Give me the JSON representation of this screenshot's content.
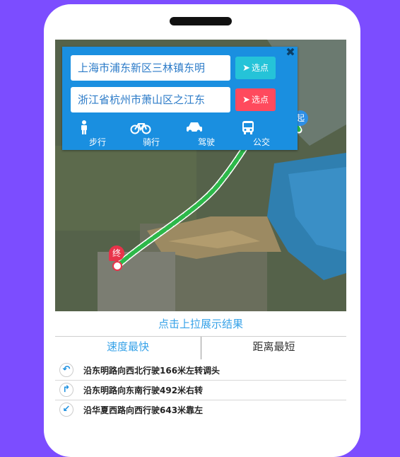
{
  "route_panel": {
    "start_address": "上海市浦东新区三林镇东明",
    "end_address": "浙江省杭州市萧山区之江东",
    "pick_start_label": "选点",
    "pick_end_label": "选点",
    "close_symbol": "✖",
    "modes": [
      {
        "label": "步行",
        "icon": "walk-icon"
      },
      {
        "label": "骑行",
        "icon": "bicycle-icon"
      },
      {
        "label": "驾驶",
        "icon": "car-icon"
      },
      {
        "label": "公交",
        "icon": "bus-icon"
      }
    ]
  },
  "map": {
    "start_marker": "起",
    "end_marker": "终",
    "route_color": "#2db84a",
    "start_color": "#2e8fe6",
    "end_color": "#e8334a"
  },
  "results": {
    "hint": "点击上拉展示结果",
    "tabs": [
      "速度最快",
      "距离最短"
    ],
    "active_tab": "速度最快",
    "steps": [
      {
        "icon": "u-turn-icon",
        "text": "沿东明路向西北行驶166米左转调头"
      },
      {
        "icon": "turn-right-icon",
        "text": "沿东明路向东南行驶492米右转"
      },
      {
        "icon": "bear-left-icon",
        "text": "沿华夏西路向西行驶643米靠左"
      }
    ]
  },
  "colors": {
    "background": "#7c4dff",
    "panel": "#1a8fe0",
    "accent": "#36a2e8",
    "pick_start": "#25c3d8",
    "pick_end": "#ff4a5d"
  }
}
